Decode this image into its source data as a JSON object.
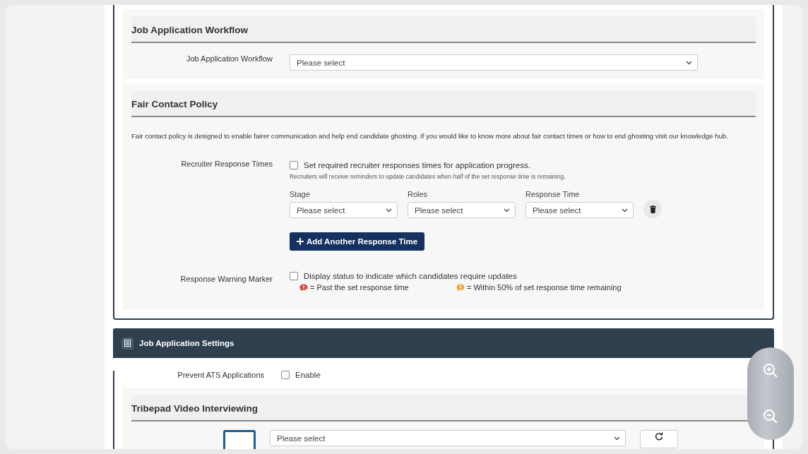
{
  "workflow": {
    "heading": "Job Application Workflow",
    "field_label": "Job Application Workflow",
    "select": {
      "placeholder": "Please select"
    }
  },
  "fair_contact": {
    "heading": "Fair Contact Policy",
    "description": "Fair contact policy is designed to enable fairer communication and help end candidate ghosting. If you would like to know more about fair contact times or how to end ghosting visit our knowledge hub.",
    "response_times": {
      "label": "Recruiter Response Times",
      "checkbox": {
        "label": "Set required recruiter responses times for application progress.",
        "checked": false
      },
      "hint": "Recruiters will receive reminders to update candidates when half of the set response time is remaining.",
      "columns": [
        {
          "label": "Stage",
          "placeholder": "Please select"
        },
        {
          "label": "Roles",
          "placeholder": "Please select"
        },
        {
          "label": "Response Time",
          "placeholder": "Please select"
        }
      ],
      "add_button": "Add Another Response Time"
    },
    "warning_marker": {
      "label": "Response Warning Marker",
      "checkbox": {
        "label": "Display status to indicate which candidates require updates",
        "checked": false
      },
      "legend": [
        {
          "text": "= Past the set response time",
          "color": "#d9443a"
        },
        {
          "text": "= Within 50% of set response time remaining",
          "color": "#f0a53c"
        }
      ]
    }
  },
  "settings": {
    "title": "Job Application Settings",
    "prevent_ats": {
      "label": "Prevent ATS Applications",
      "checkbox": {
        "label": "Enable",
        "checked": false
      }
    },
    "video": {
      "heading": "Tribepad Video Interviewing",
      "select": {
        "placeholder": "Please select"
      }
    }
  }
}
